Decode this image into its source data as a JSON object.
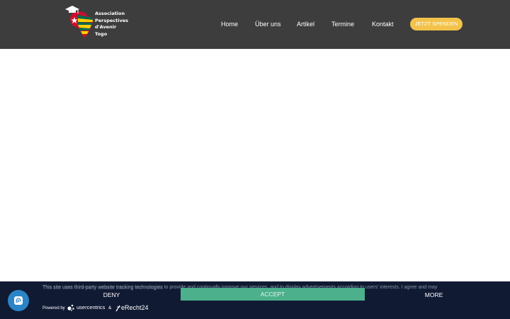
{
  "header": {
    "logo": {
      "lines": [
        "Association",
        "Perspectives",
        "d'Avenir",
        "Togo"
      ]
    },
    "nav": [
      {
        "label": "Home"
      },
      {
        "label": "Über uns"
      },
      {
        "label": "Artikel"
      },
      {
        "label": "Termine"
      },
      {
        "label": "Kontakt"
      }
    ],
    "donate_label": "JETZT SPENDEN"
  },
  "cookie_banner": {
    "text": "This site uses third-party website tracking technologies to provide and continually improve our services, and to display advertisements according to users' interests. I agree and may",
    "ghost_text": "This site uses third-party website tracking technologies",
    "buttons": {
      "deny": "DENY",
      "accept": "ACCEPT",
      "more": "MORE"
    },
    "powered_by": "Powered by",
    "usercentrics": "usercentrics",
    "ampersand": "&",
    "erecht": "eRecht24",
    "privacy_icon": "fingerprint-icon"
  },
  "colors": {
    "header_bg": "#3d3d3d",
    "donate_bg": "#f2c24a",
    "banner_bg": "#101a33",
    "accept_bg": "#4bb08b",
    "privacy_button_bg": "#2a84c6"
  }
}
